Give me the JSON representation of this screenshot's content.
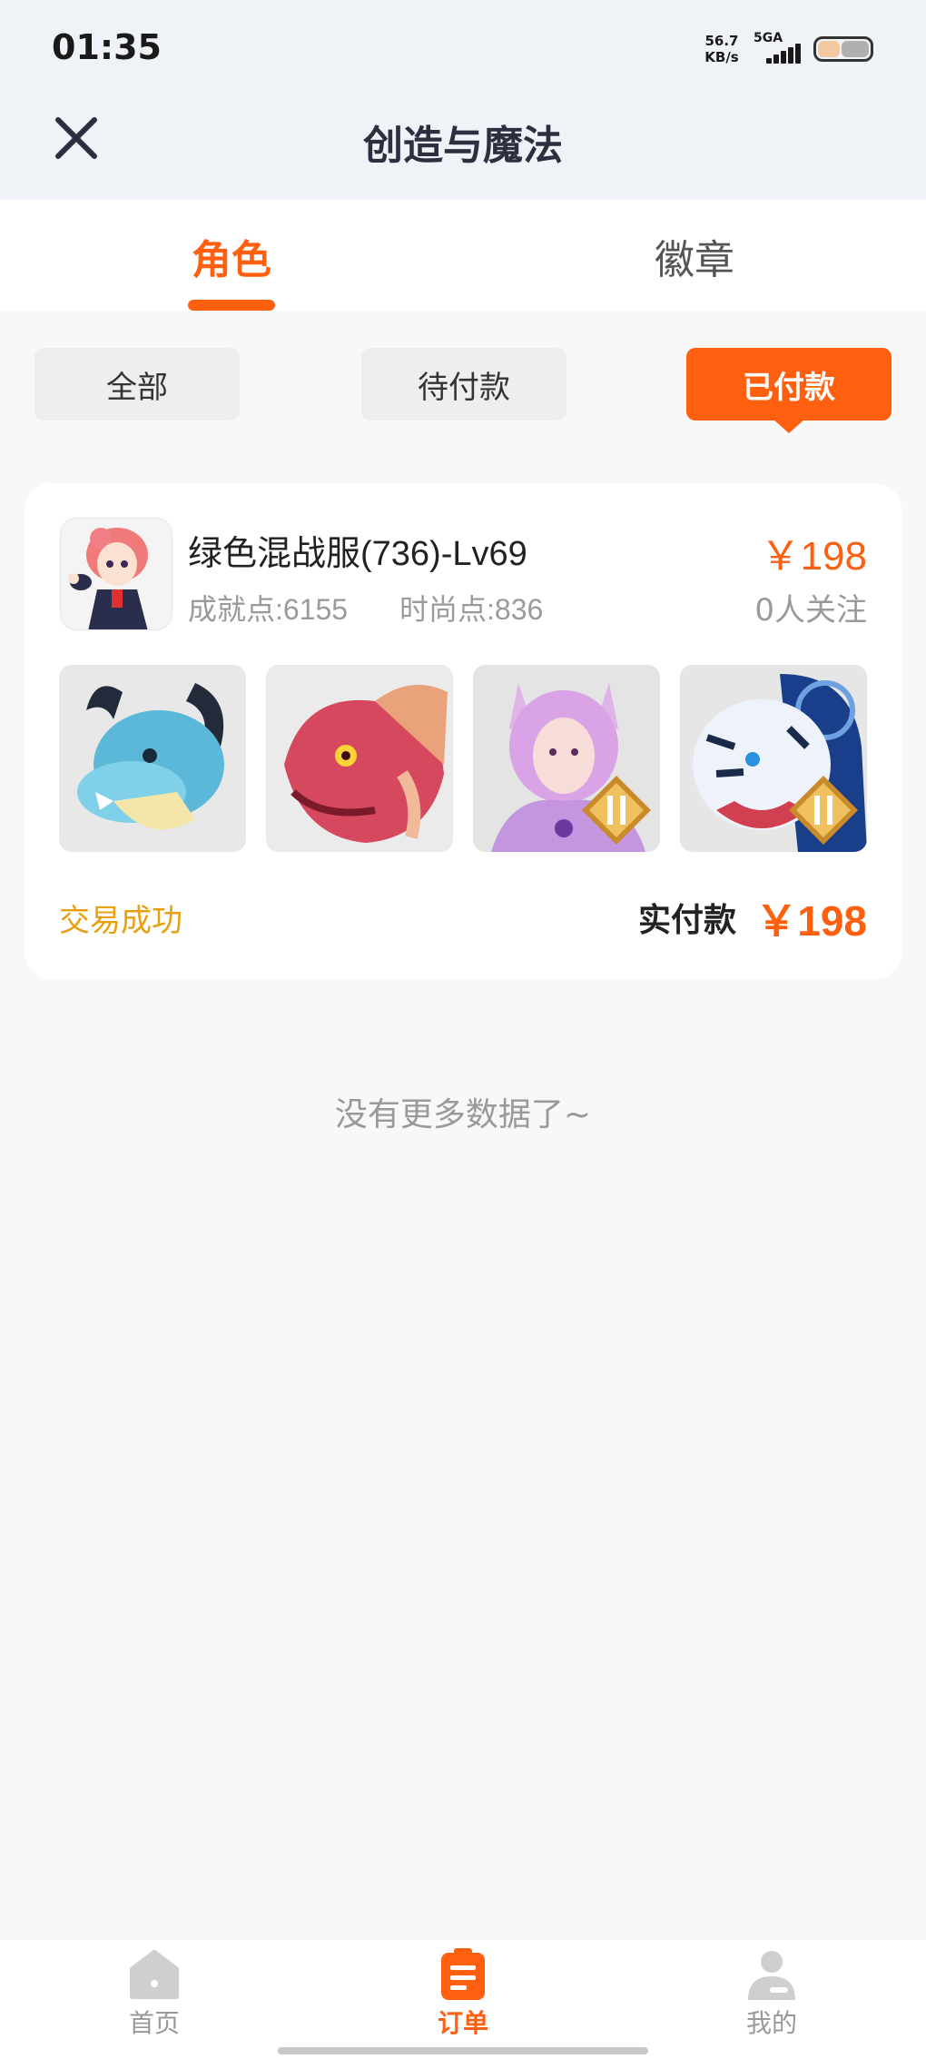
{
  "status_bar": {
    "time": "01:35",
    "net_speed_value": "56.7",
    "net_speed_unit": "KB/s",
    "network": "5GA"
  },
  "header": {
    "title": "创造与魔法",
    "close_icon": "close-icon"
  },
  "tabs": [
    {
      "label": "角色",
      "active": true
    },
    {
      "label": "徽章",
      "active": false
    }
  ],
  "filters": [
    {
      "label": "全部",
      "active": false
    },
    {
      "label": "待付款",
      "active": false
    },
    {
      "label": "已付款",
      "active": true
    }
  ],
  "order": {
    "title": "绿色混战服(736)-Lv69",
    "achievement": "成就点:6155",
    "fashion": "时尚点:836",
    "price": "￥198",
    "followers": "0人关注",
    "thumbnails": [
      "blue-dragon-mount",
      "red-dragon-mount",
      "fox-spirit-pet",
      "white-tiger-mount"
    ],
    "status": "交易成功",
    "paid_label": "实付款",
    "paid_amount": "￥198"
  },
  "list_end": "没有更多数据了~",
  "bottom_nav": [
    {
      "label": "首页",
      "icon": "home-icon",
      "active": false
    },
    {
      "label": "订单",
      "icon": "order-icon",
      "active": true
    },
    {
      "label": "我的",
      "icon": "profile-icon",
      "active": false
    }
  ],
  "colors": {
    "accent": "#ff6010",
    "status_success": "#e8a010",
    "header_bg": "#eff2f6"
  }
}
